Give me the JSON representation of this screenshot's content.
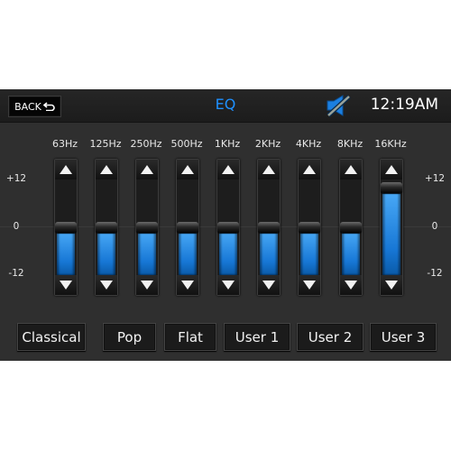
{
  "header": {
    "back_label": "BACK",
    "title": "EQ",
    "mute_icon": "speaker-muted-icon",
    "clock": "12:19AM"
  },
  "scale": {
    "max_label": "+12",
    "mid_label": "0",
    "min_label": "-12",
    "min": -12,
    "max": 12
  },
  "bands": [
    {
      "label": "63Hz",
      "gain_db": 0
    },
    {
      "label": "125Hz",
      "gain_db": 0
    },
    {
      "label": "250Hz",
      "gain_db": 0
    },
    {
      "label": "500Hz",
      "gain_db": 0
    },
    {
      "label": "1KHz",
      "gain_db": 0
    },
    {
      "label": "2KHz",
      "gain_db": 0
    },
    {
      "label": "4KHz",
      "gain_db": 0
    },
    {
      "label": "8KHz",
      "gain_db": 0
    },
    {
      "label": "16KHz",
      "gain_db": 10
    }
  ],
  "presets": [
    "Classical",
    "Pop",
    "Flat",
    "User 1",
    "User 2",
    "User 3"
  ],
  "colors": {
    "accent": "#1e90ff",
    "fill_top": "#4aaaf7",
    "fill_bottom": "#0a5aa8",
    "background": "#2f2f2f"
  }
}
